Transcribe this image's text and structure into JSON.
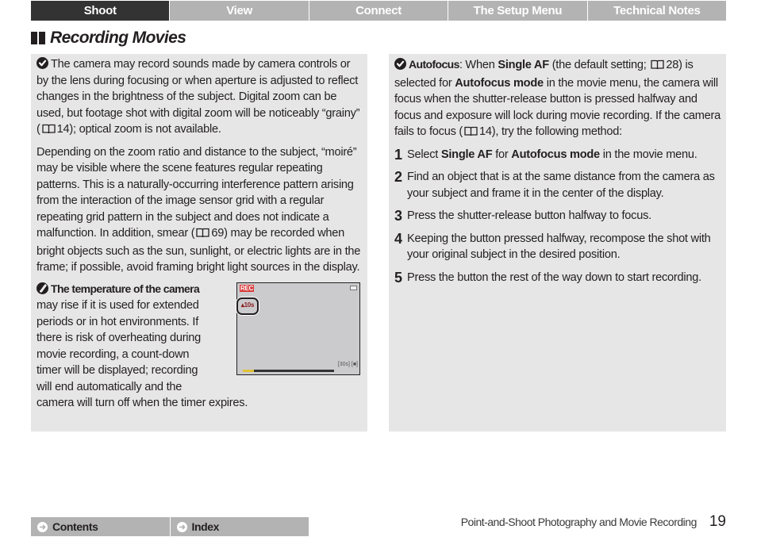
{
  "top_nav": {
    "tabs": [
      {
        "label": "Shoot",
        "active": true
      },
      {
        "label": "View",
        "active": false
      },
      {
        "label": "Connect",
        "active": false
      },
      {
        "label": "The Setup Menu",
        "active": false
      },
      {
        "label": "Technical Notes",
        "active": false
      }
    ]
  },
  "page_title": "Recording Movies",
  "left_panel": {
    "note1": {
      "icon": "check-circle-icon",
      "before_ref": "The camera may record sounds made by camera controls or by the lens during focusing or when aperture is adjusted to reflect changes in the brightness of the subject. Digital zoom can be used, but footage shot with digital zoom will be noticeably “grainy” (",
      "ref_page": "14",
      "after_ref": "); optical zoom is not available."
    },
    "note2": {
      "before_ref": "Depending on the zoom ratio and distance to the subject, “moiré” may be visible where the scene features regular repeating patterns. This is a naturally-occurring interference pattern arising from the interaction of the image sensor grid with a regular repeating grid pattern in the subject and does not indicate a malfunction. In addition, smear (",
      "ref_page": "69",
      "after_ref": ") may be recorded when bright objects such as the sun, sunlight, or electric lights are in the frame; if possible, avoid framing bright light sources in the display."
    },
    "temperature_note": {
      "icon": "pencil-note-icon",
      "heading": "The temperature of the camera",
      "body": "may rise if it is used for extended periods or in hot environments. If there is risk of overheating during movie recording, a count-down timer will be displayed; recording will end automatically and the",
      "last_line": "camera will turn off when the timer expires."
    },
    "lcd_illustration": {
      "rec_label": "REC",
      "countdown": "▴10s",
      "info": "[30s] [■]",
      "progress_fraction": 0.12
    }
  },
  "right_panel": {
    "intro": {
      "icon": "check-circle-icon",
      "lead": "Autofocus",
      "t1": ": When ",
      "b1": "Single AF",
      "t2": " (the default setting; ",
      "ref1": "28",
      "t3": ") is selected for ",
      "b2": "Autofocus mode",
      "t4": " in the movie menu, the camera will focus when the shutter-release button is pressed halfway and focus and exposure will lock during movie recording. If the camera fails to focus (",
      "ref2": "14",
      "t5": "), try the following method:"
    },
    "steps": [
      {
        "num": "1",
        "t1": "Select ",
        "b1": "Single AF",
        "t2": " for ",
        "b2": "Autofocus mode",
        "t3": " in the movie menu."
      },
      {
        "num": "2",
        "text": "Find an object that is at the same distance from the camera as your subject and frame it in the center of the display."
      },
      {
        "num": "3",
        "text": "Press the shutter-release button halfway to focus."
      },
      {
        "num": "4",
        "text": "Keeping the button pressed halfway, recompose the shot with your original subject in the desired position."
      },
      {
        "num": "5",
        "text": "Press the button the rest of the way down to start recording."
      }
    ]
  },
  "footer": {
    "buttons": [
      {
        "label": "Contents",
        "icon": "arrow-right-circle-icon"
      },
      {
        "label": "Index",
        "icon": "arrow-right-circle-icon"
      }
    ],
    "section": "Point-and-Shoot Photography and Movie Recording",
    "page_number": "19"
  }
}
